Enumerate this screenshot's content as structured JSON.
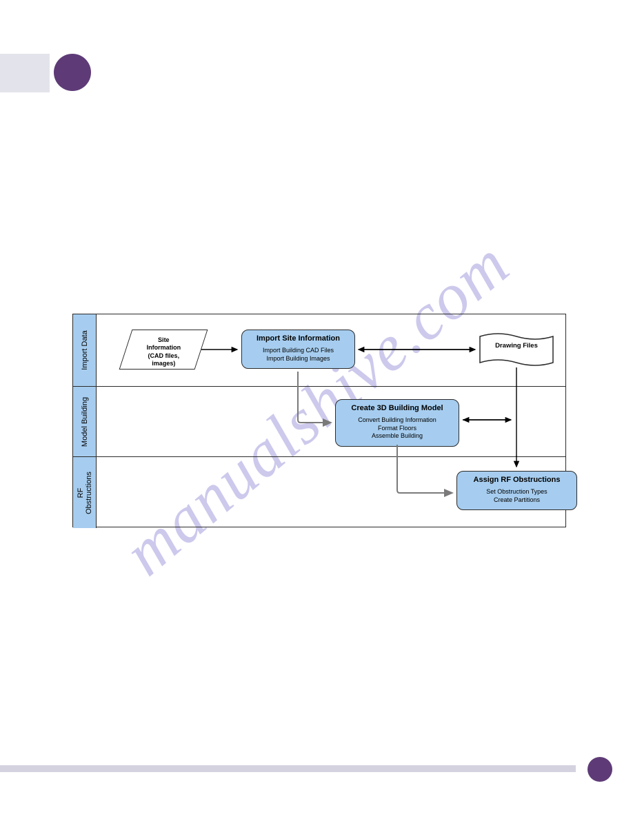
{
  "lanes": {
    "import": "Import Data",
    "model": "Model Building",
    "rf": "RF\nObstructions"
  },
  "shapes": {
    "site_info": {
      "l1": "Site",
      "l2": "Information",
      "l3": "(CAD files,",
      "l4": "images)"
    },
    "import_site": {
      "title": "Import Site Information",
      "l1": "Import Building CAD Files",
      "l2": "Import Building Images"
    },
    "drawing_files": "Drawing Files",
    "create_model": {
      "title": "Create 3D Building Model",
      "l1": "Convert Building Information",
      "l2": "Format Floors",
      "l3": "Assemble Building"
    },
    "assign_rf": {
      "title": "Assign RF Obstructions",
      "l1": "Set Obstruction Types",
      "l2": "Create Partitions"
    }
  },
  "watermark": "manualshive.com"
}
